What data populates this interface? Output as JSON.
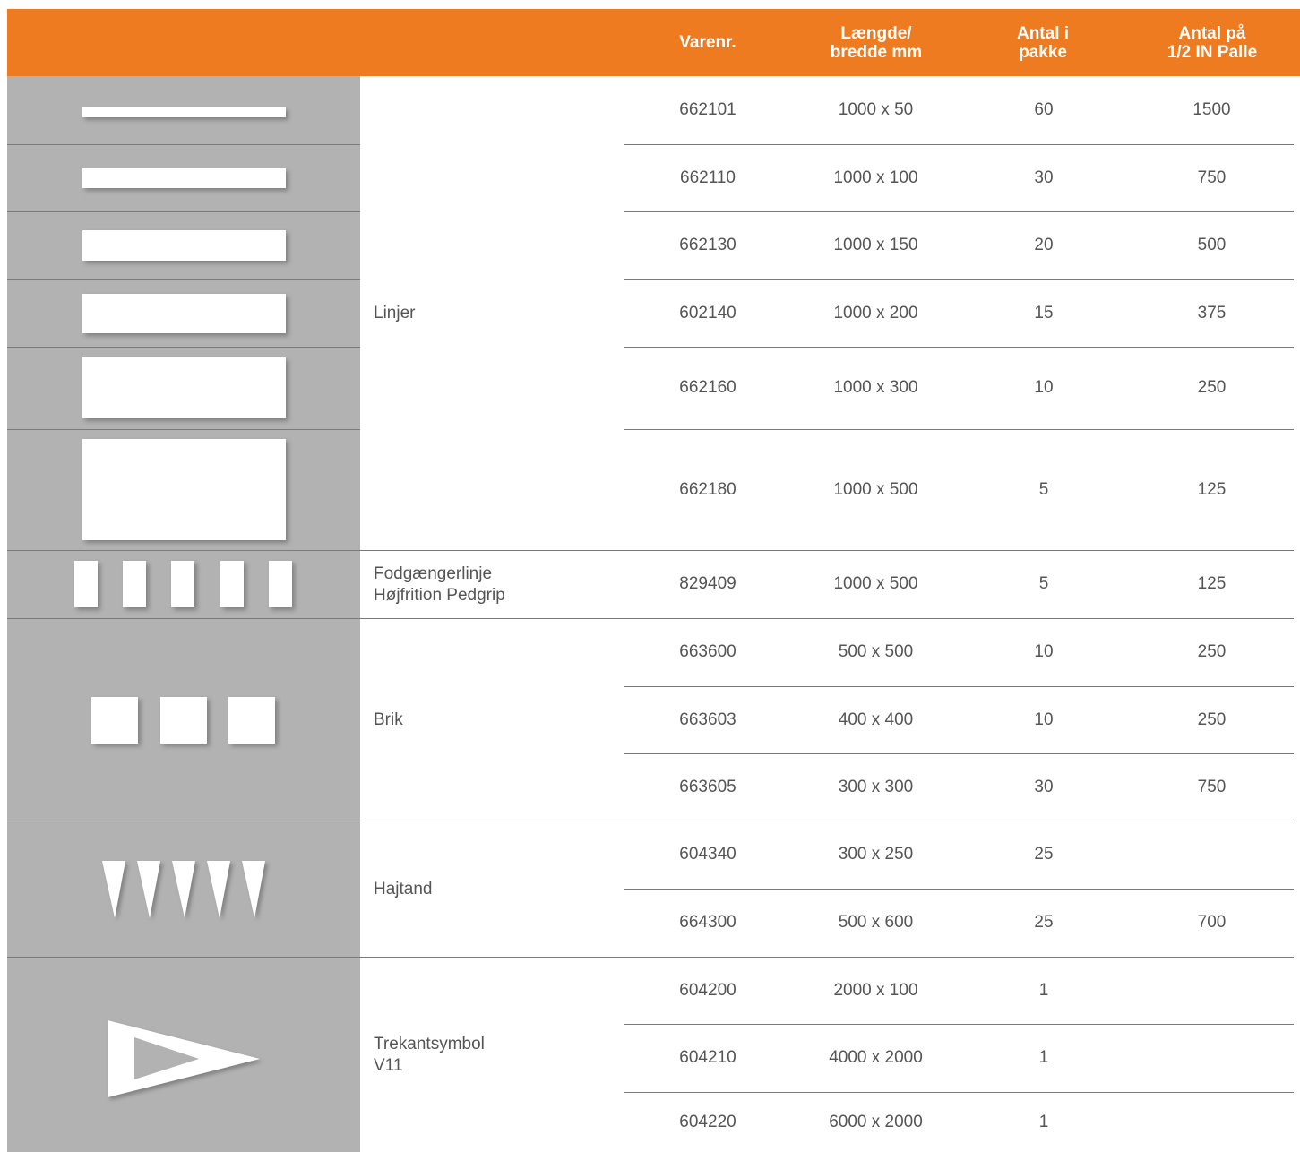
{
  "header": {
    "col_varenr": "Varenr.",
    "col_size": "Længde/\nbredde mm",
    "col_pack": "Antal i\npakke",
    "col_pallet": "Antal på\n1/2 IN Palle"
  },
  "groups": {
    "linjer": "Linjer",
    "fodgaenger": "Fodgængerlinje\nHøjfrition Pedgrip",
    "brik": "Brik",
    "hajtand": "Hajtand",
    "trekant": "Trekantsymbol\nV11"
  },
  "rows": [
    {
      "varenr": "662101",
      "size": "1000 x 50",
      "pack": "60",
      "pallet": "1500"
    },
    {
      "varenr": "662110",
      "size": "1000 x 100",
      "pack": "30",
      "pallet": "750"
    },
    {
      "varenr": "662130",
      "size": "1000 x 150",
      "pack": "20",
      "pallet": "500"
    },
    {
      "varenr": "602140",
      "size": "1000 x 200",
      "pack": "15",
      "pallet": "375"
    },
    {
      "varenr": "662160",
      "size": "1000 x 300",
      "pack": "10",
      "pallet": "250"
    },
    {
      "varenr": "662180",
      "size": "1000 x 500",
      "pack": "5",
      "pallet": "125"
    },
    {
      "varenr": "829409",
      "size": "1000 x 500",
      "pack": "5",
      "pallet": "125"
    },
    {
      "varenr": "663600",
      "size": "500 x 500",
      "pack": "10",
      "pallet": "250"
    },
    {
      "varenr": "663603",
      "size": "400 x 400",
      "pack": "10",
      "pallet": "250"
    },
    {
      "varenr": "663605",
      "size": "300 x 300",
      "pack": "30",
      "pallet": "750"
    },
    {
      "varenr": "604340",
      "size": "300 x 250",
      "pack": "25",
      "pallet": ""
    },
    {
      "varenr": "664300",
      "size": "500 x 600",
      "pack": "25",
      "pallet": "700"
    },
    {
      "varenr": "604200",
      "size": "2000 x 100",
      "pack": "1",
      "pallet": ""
    },
    {
      "varenr": "604210",
      "size": "4000 x 2000",
      "pack": "1",
      "pallet": ""
    },
    {
      "varenr": "604220",
      "size": "6000 x 2000",
      "pack": "1",
      "pallet": ""
    }
  ],
  "colors": {
    "accent": "#ef7b21",
    "image_column": "#b2b2b2",
    "text": "#555555",
    "marking": "#ffffff"
  },
  "icons": [
    "line-marking-50-icon",
    "line-marking-100-icon",
    "line-marking-150-icon",
    "line-marking-200-icon",
    "line-marking-300-icon",
    "line-marking-500-icon",
    "pedestrian-crossing-icon",
    "square-tiles-icon",
    "shark-teeth-icon",
    "triangle-symbol-icon"
  ]
}
